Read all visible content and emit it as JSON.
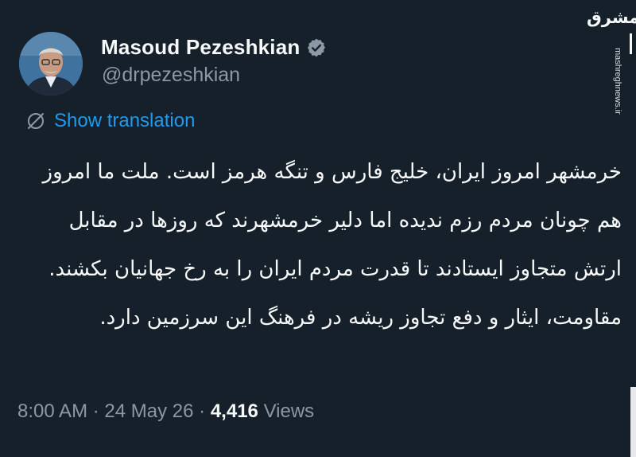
{
  "author": {
    "display_name": "Masoud Pezeshkian",
    "handle": "@drpezeshkian",
    "verified": true
  },
  "translate": {
    "label": "Show translation",
    "icon": "globe-slash-icon"
  },
  "tweet": {
    "paragraphs": [
      "خرمشهر امروز ایران، خلیج فارس و تنگه هرمز است. ملت ما امروز هم چونان مردم رزم ندیده اما دلیر خرمشهرند که روزها در مقابل ارتش متجاوز ایستادند تا قدرت مردم ایران را به رخ جهانیان بکشند.",
      "مقاومت، ایثار و دفع تجاوز ریشه در فرهنگ این سرزمین دارد."
    ]
  },
  "meta": {
    "time": "8:00 AM",
    "separator": "·",
    "date": "24 May 26",
    "views_count": "4,416",
    "views_label": "Views"
  },
  "watermark": {
    "logo_text": "مشرق",
    "site": "mashreghnews.ir"
  },
  "colors": {
    "background": "#15202b",
    "text": "#f7f9f9",
    "secondary": "#8b98a5",
    "accent": "#1d9bf0"
  }
}
